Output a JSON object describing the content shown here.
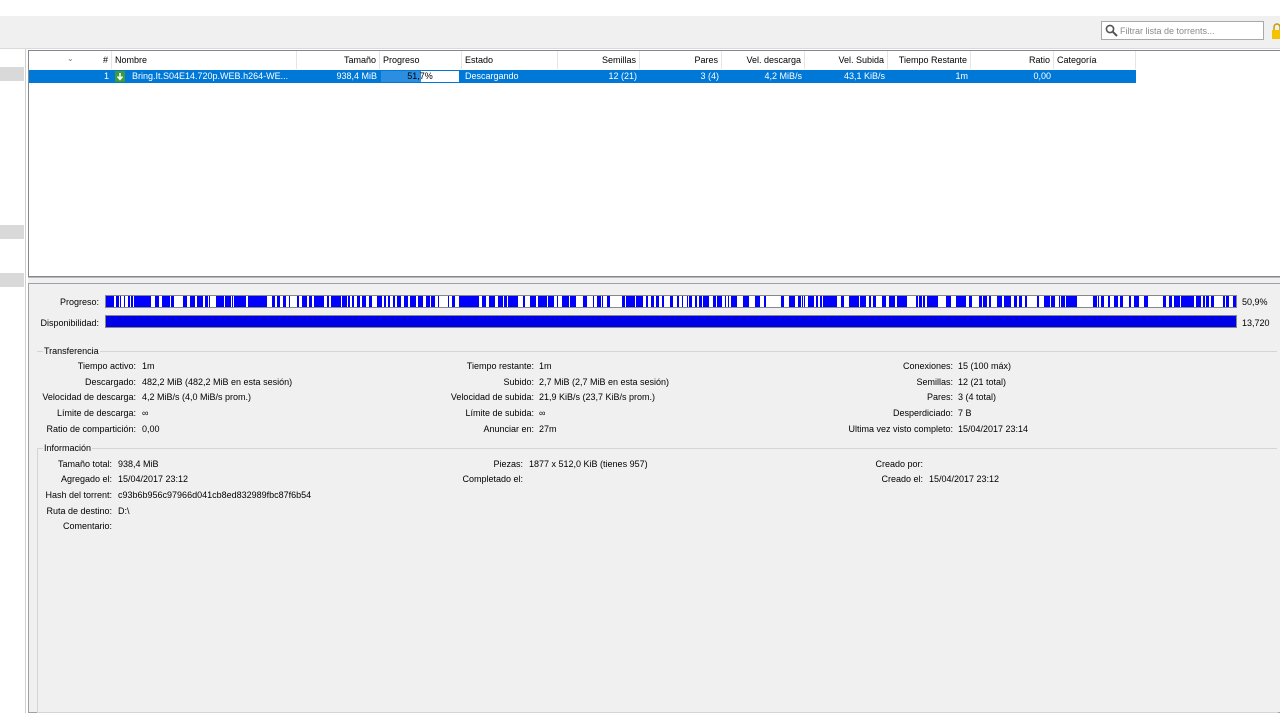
{
  "toolbar": {
    "filter_placeholder": "Filtrar lista de torrents..."
  },
  "table": {
    "columns": [
      "#",
      "Nombre",
      "Tamaño",
      "Progreso",
      "Estado",
      "Semillas",
      "Pares",
      "Vel. descarga",
      "Vel. Subida",
      "Tiempo Restante",
      "Ratio",
      "Categoría"
    ],
    "rows": [
      {
        "num": "1",
        "name": "Bring.It.S04E14.720p.WEB.h264-WE...",
        "size": "938,4 MiB",
        "progress": "51,7%",
        "progress_fraction": 0.517,
        "status": "Descargando",
        "seeds": "12 (21)",
        "peers": "3 (4)",
        "down_speed": "4,2 MiB/s",
        "up_speed": "43,1 KiB/s",
        "eta": "1m",
        "ratio": "0,00",
        "category": ""
      }
    ]
  },
  "bars": {
    "progress_label": "Progreso:",
    "progress_value": "50,9%",
    "progress_color": "#0000ff",
    "availability_label": "Disponibilidad:",
    "availability_value": "13,720",
    "availability_color": "#0000e6"
  },
  "transfer": {
    "title": "Transferencia",
    "col1": [
      {
        "k": "Tiempo activo:",
        "v": "1m"
      },
      {
        "k": "Descargado:",
        "v": "482,2 MiB (482,2 MiB en esta sesión)"
      },
      {
        "k": "Velocidad de descarga:",
        "v": "4,2 MiB/s (4,0 MiB/s prom.)"
      },
      {
        "k": "Límite de descarga:",
        "v": "∞"
      },
      {
        "k": "Ratio de compartición:",
        "v": "0,00"
      }
    ],
    "col2": [
      {
        "k": "Tiempo restante:",
        "v": "1m"
      },
      {
        "k": "Subido:",
        "v": "2,7 MiB (2,7 MiB en esta sesión)"
      },
      {
        "k": "Velocidad de subida:",
        "v": "21,9 KiB/s (23,7 KiB/s prom.)"
      },
      {
        "k": "Límite de subida:",
        "v": "∞"
      },
      {
        "k": "Anunciar en:",
        "v": "27m"
      }
    ],
    "col3": [
      {
        "k": "Conexiones:",
        "v": "15 (100 máx)"
      },
      {
        "k": "Semillas:",
        "v": "12 (21 total)"
      },
      {
        "k": "Pares:",
        "v": "3 (4 total)"
      },
      {
        "k": "Desperdiciado:",
        "v": "7 B"
      },
      {
        "k": "Ultima vez visto completo:",
        "v": "15/04/2017 23:14"
      }
    ]
  },
  "info": {
    "title": "Información",
    "col1": [
      {
        "k": "Tamaño total:",
        "v": "938,4 MiB"
      },
      {
        "k": "Agregado el:",
        "v": "15/04/2017 23:12"
      },
      {
        "k": "Hash del torrent:",
        "v": "c93b6b956c97966d041cb8ed832989fbc87f6b54"
      },
      {
        "k": "Ruta de destino:",
        "v": "D:\\"
      },
      {
        "k": "Comentario:",
        "v": ""
      }
    ],
    "col2": [
      {
        "k": "Piezas:",
        "v": "1877 x 512,0 KiB (tienes 957)"
      },
      {
        "k": "Completado el:",
        "v": ""
      }
    ],
    "col3": [
      {
        "k": "Creado por:",
        "v": ""
      },
      {
        "k": "Creado el:",
        "v": "15/04/2017 23:12"
      }
    ]
  }
}
